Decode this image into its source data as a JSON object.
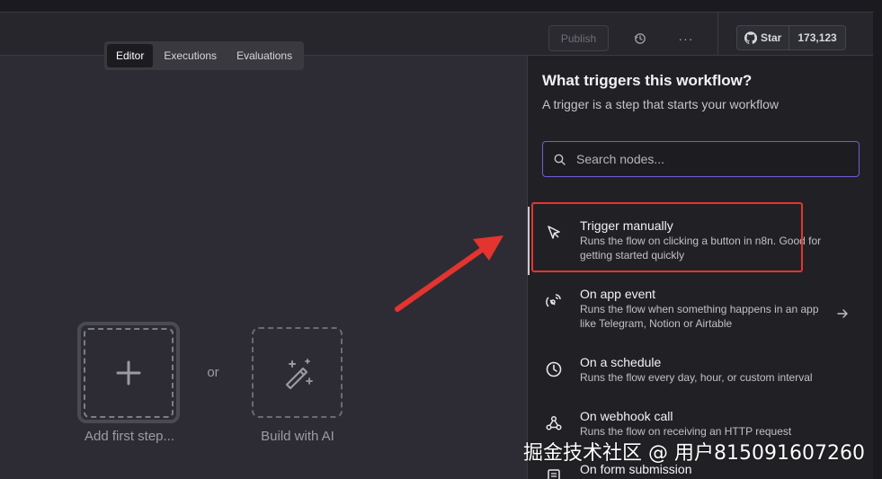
{
  "header": {
    "publish_label": "Publish",
    "star_label": "Star",
    "star_count": "173,123",
    "more_label": "···"
  },
  "tabs": [
    {
      "label": "Editor",
      "active": true
    },
    {
      "label": "Executions",
      "active": false
    },
    {
      "label": "Evaluations",
      "active": false
    }
  ],
  "canvas": {
    "add_first_step_label": "Add first step...",
    "or_label": "or",
    "build_ai_label": "Build with AI"
  },
  "panel": {
    "title": "What triggers this workflow?",
    "subtitle": "A trigger is a step that starts your workflow",
    "search_placeholder": "Search nodes...",
    "items": [
      {
        "name": "Trigger manually",
        "desc": "Runs the flow on clicking a button in n8n. Good for getting started quickly",
        "icon": "cursor-icon"
      },
      {
        "name": "On app event",
        "desc": "Runs the flow when something happens in an app like Telegram, Notion or Airtable",
        "icon": "satellite-icon"
      },
      {
        "name": "On a schedule",
        "desc": "Runs the flow every day, hour, or custom interval",
        "icon": "clock-icon"
      },
      {
        "name": "On webhook call",
        "desc": "Runs the flow on receiving an HTTP request",
        "icon": "webhook-icon"
      },
      {
        "name": "On form submission",
        "desc": "",
        "icon": "form-icon"
      }
    ]
  },
  "annotation": {
    "arrow_color": "#e3342f",
    "highlight_color": "#e3342f"
  },
  "watermark": "掘金技术社区 @ 用户815091607260"
}
